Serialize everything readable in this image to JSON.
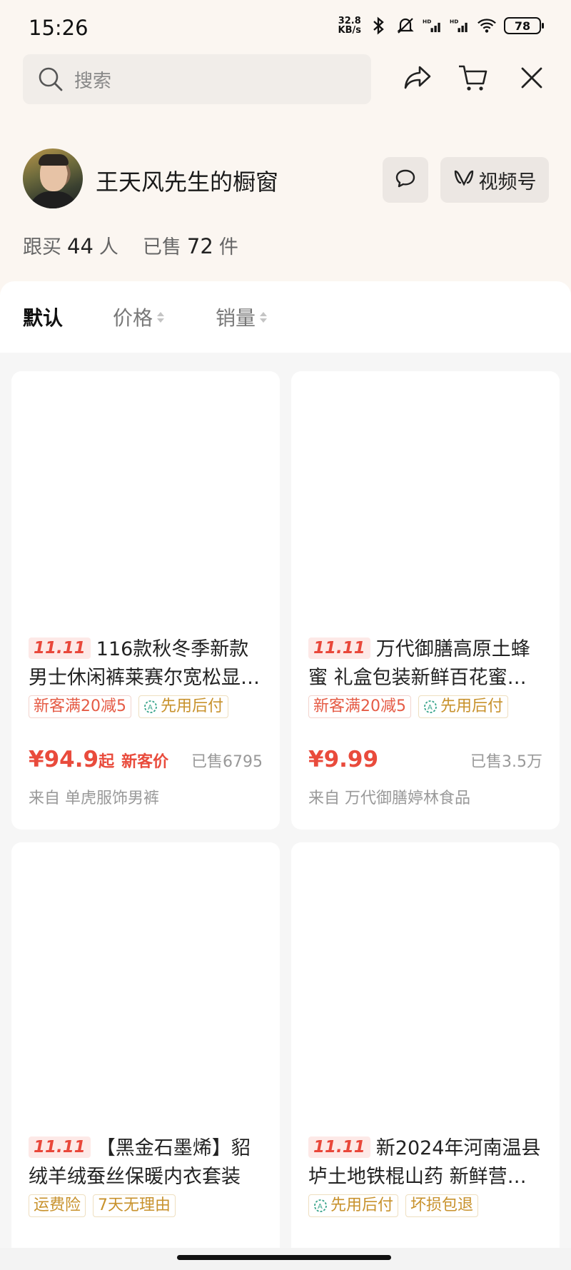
{
  "status_bar": {
    "time": "15:26",
    "net_speed_value": "32.8",
    "net_speed_unit": "KB/s",
    "battery": "78"
  },
  "search": {
    "placeholder": "搜索"
  },
  "profile": {
    "shop_name": "王天风先生的橱窗",
    "channel_label": "视频号",
    "followers_label": "跟买",
    "followers_count": "44",
    "followers_unit": "人",
    "sold_label": "已售",
    "sold_count": "72",
    "sold_unit": "件"
  },
  "sort": {
    "default": "默认",
    "price": "价格",
    "sales": "销量"
  },
  "products": [
    {
      "badge": "11.11",
      "title": "116款秋冬季新款男士休闲裤莱赛尔宽松显…",
      "tags": [
        "新客满20减5",
        "先用后付"
      ],
      "price": "¥94.9",
      "price_suffix": "起",
      "price_note": "新客价",
      "sold": "已售6795",
      "from": "来自 单虎服饰男裤"
    },
    {
      "badge": "11.11",
      "title": "万代御膳高原土蜂蜜 礼盒包装新鲜百花蜜…",
      "tags": [
        "新客满20减5",
        "先用后付"
      ],
      "price": "¥9.99",
      "sold": "已售3.5万",
      "from": "来自 万代御膳婷林食品"
    },
    {
      "badge": "11.11",
      "title": "【黑金石墨烯】貂绒羊绒蚕丝保暖内衣套装",
      "tags": [
        "运费险",
        "7天无理由"
      ]
    },
    {
      "badge": "11.11",
      "title": "新2024年河南温县垆土地铁棍山药 新鲜营…",
      "tags": [
        "先用后付",
        "坏损包退"
      ]
    }
  ],
  "colors": {
    "accent_red": "#e94b3c",
    "gold": "#c8922c",
    "header_bg": "#fbf6f1"
  }
}
